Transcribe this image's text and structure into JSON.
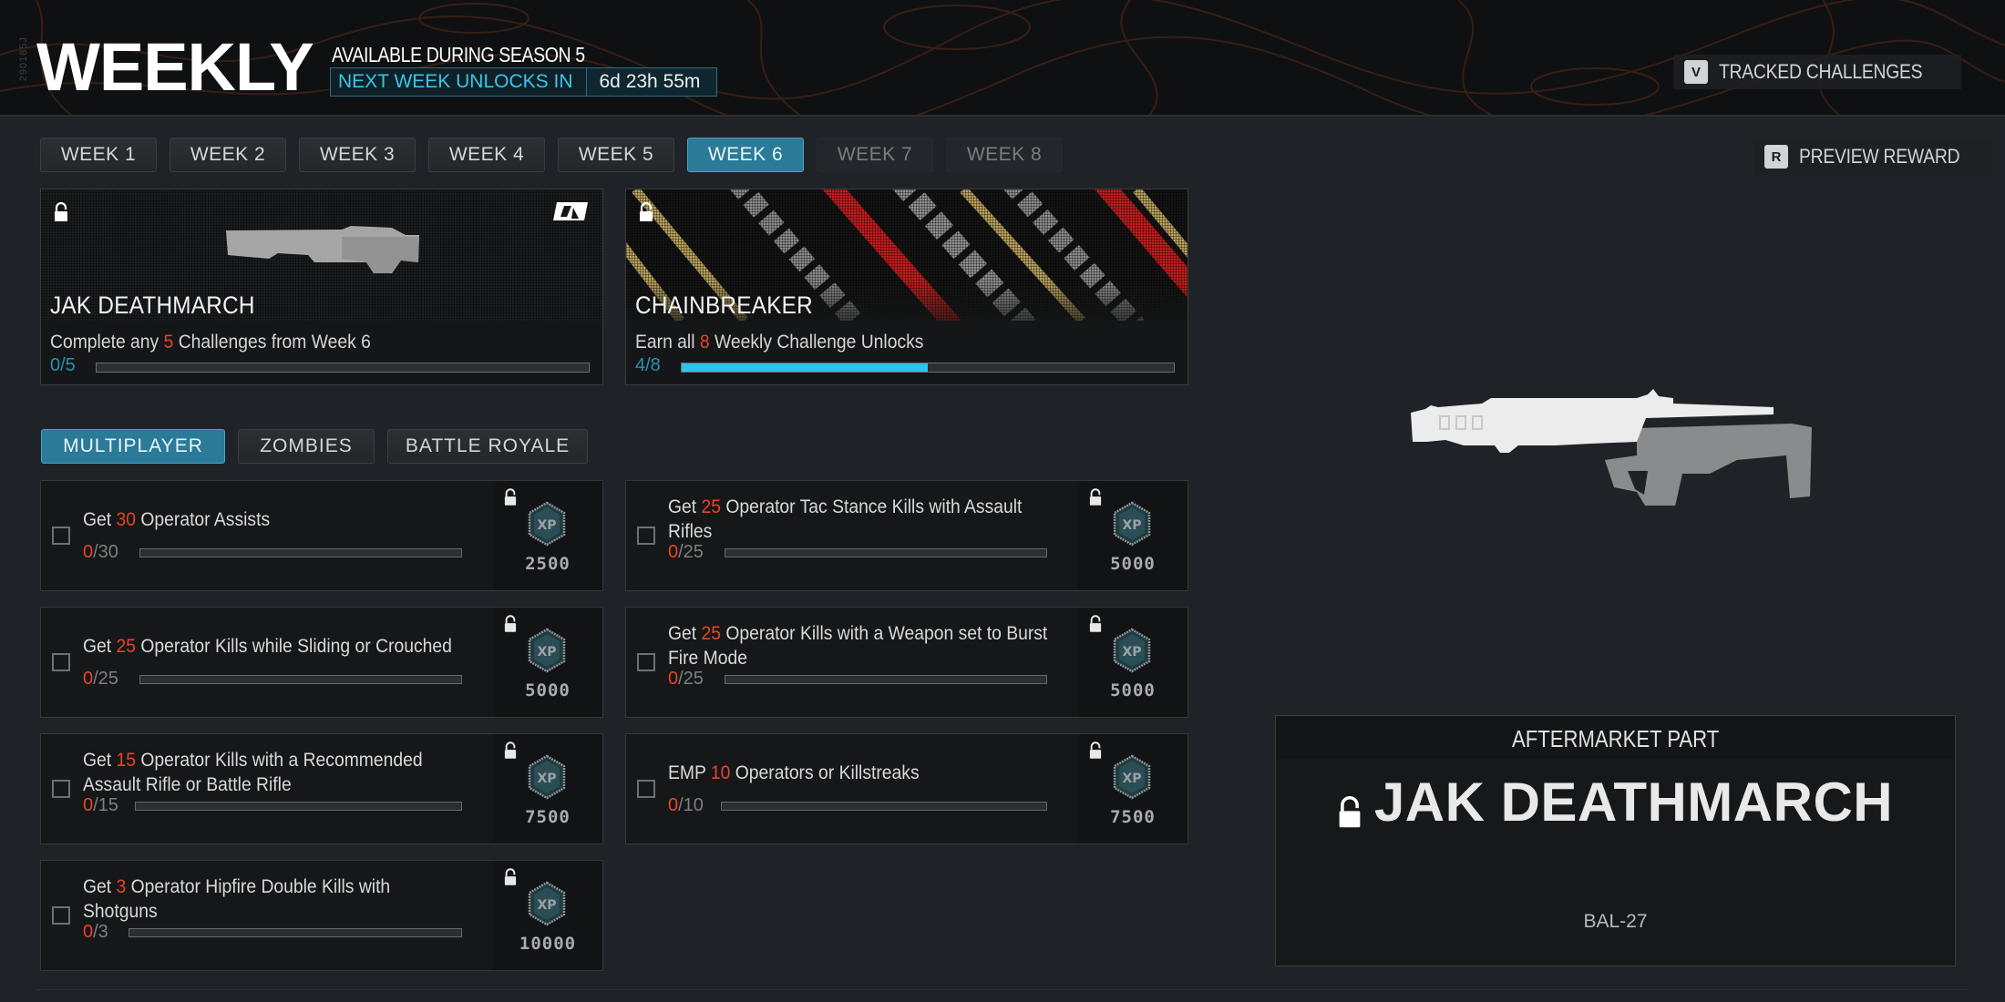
{
  "header": {
    "title": "WEEKLY",
    "build_id": "290185J",
    "season_label": "AVAILABLE DURING SEASON 5",
    "next_unlock_label": "NEXT WEEK UNLOCKS IN",
    "next_unlock_time": "6d 23h 55m",
    "tracked": {
      "key": "V",
      "label": "TRACKED CHALLENGES"
    },
    "preview": {
      "key": "R",
      "label": "PREVIEW REWARD"
    }
  },
  "week_tabs": [
    {
      "label": "WEEK 1",
      "state": "unlocked"
    },
    {
      "label": "WEEK 2",
      "state": "unlocked"
    },
    {
      "label": "WEEK 3",
      "state": "unlocked"
    },
    {
      "label": "WEEK 4",
      "state": "unlocked"
    },
    {
      "label": "WEEK 5",
      "state": "unlocked"
    },
    {
      "label": "WEEK 6",
      "state": "active"
    },
    {
      "label": "WEEK 7",
      "state": "locked"
    },
    {
      "label": "WEEK 8",
      "state": "locked"
    }
  ],
  "rewards": [
    {
      "name": "JAK DEATHMARCH",
      "desc_pre": "Complete any ",
      "desc_num": "5",
      "desc_post": " Challenges from Week 6",
      "progress_text": "0/5",
      "progress": 0.0,
      "icon": "aftermarket-logo-icon"
    },
    {
      "name": "CHAINBREAKER",
      "desc_pre": "Earn all ",
      "desc_num": "8",
      "desc_post": " Weekly Challenge Unlocks",
      "progress_text": "4/8",
      "progress": 0.5
    }
  ],
  "mode_tabs": [
    {
      "label": "MULTIPLAYER",
      "active": true
    },
    {
      "label": "ZOMBIES",
      "active": false
    },
    {
      "label": "BATTLE ROYALE",
      "active": false
    }
  ],
  "challenges": [
    {
      "pre": "Get ",
      "num": "30",
      "post": " Operator Assists",
      "cur": "0",
      "total": "/30",
      "progress": 0,
      "xp": "2500"
    },
    {
      "pre": "Get ",
      "num": "25",
      "post": " Operator Tac Stance Kills with Assault Rifles",
      "cur": "0",
      "total": "/25",
      "progress": 0,
      "xp": "5000"
    },
    {
      "pre": "Get ",
      "num": "25",
      "post": " Operator Kills while Sliding or Crouched",
      "cur": "0",
      "total": "/25",
      "progress": 0,
      "xp": "5000"
    },
    {
      "pre": "Get ",
      "num": "25",
      "post": " Operator Kills with a Weapon set to Burst Fire Mode",
      "cur": "0",
      "total": "/25",
      "progress": 0,
      "xp": "5000"
    },
    {
      "pre": "Get ",
      "num": "15",
      "post": " Operator Kills with a Recommended Assault Rifle or Battle Rifle",
      "cur": "0",
      "total": "/15",
      "progress": 0,
      "xp": "7500"
    },
    {
      "pre": "EMP ",
      "num": "10",
      "post": " Operators or Killstreaks",
      "cur": "0",
      "total": "/10",
      "progress": 0,
      "xp": "7500"
    },
    {
      "pre": "Get ",
      "num": "3",
      "post": " Operator Hipfire Double Kills with Shotguns",
      "cur": "0",
      "total": "/3",
      "progress": 0,
      "xp": "10000"
    }
  ],
  "detail": {
    "category": "AFTERMARKET PART",
    "name": "JAK DEATHMARCH",
    "weapon": "BAL-27"
  },
  "colors": {
    "accent": "#2a7a98",
    "progress_fill": "#2bc6ee",
    "highlight_red": "#e8432a"
  }
}
